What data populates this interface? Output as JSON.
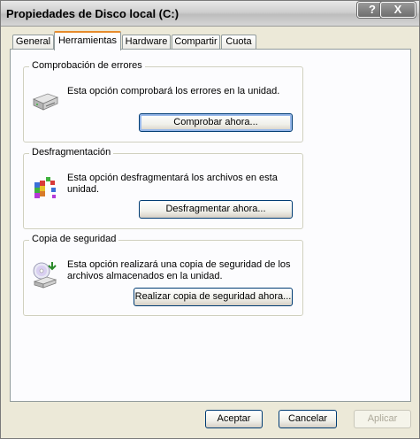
{
  "window": {
    "title": "Propiedades de Disco local (C:)",
    "help_glyph": "?",
    "close_glyph": "X"
  },
  "tabs": [
    {
      "label": "General"
    },
    {
      "label": "Herramientas",
      "active": true
    },
    {
      "label": "Hardware"
    },
    {
      "label": "Compartir"
    },
    {
      "label": "Cuota"
    }
  ],
  "groups": {
    "error_check": {
      "title": "Comprobación de errores",
      "text": "Esta opción comprobará los errores en la unidad.",
      "button": "Comprobar ahora..."
    },
    "defrag": {
      "title": "Desfragmentación",
      "text": "Esta opción desfragmentará los archivos en esta unidad.",
      "button": "Desfragmentar ahora..."
    },
    "backup": {
      "title": "Copia de seguridad",
      "text": "Esta opción realizará una copia de seguridad de los archivos almacenados en la unidad.",
      "button": "Realizar copia de seguridad ahora..."
    }
  },
  "footer": {
    "ok": "Aceptar",
    "cancel": "Cancelar",
    "apply": "Aplicar",
    "apply_enabled": false
  },
  "icons": {
    "error_check": "hard-drive-icon",
    "defrag": "defragment-icon",
    "backup": "backup-icon"
  }
}
